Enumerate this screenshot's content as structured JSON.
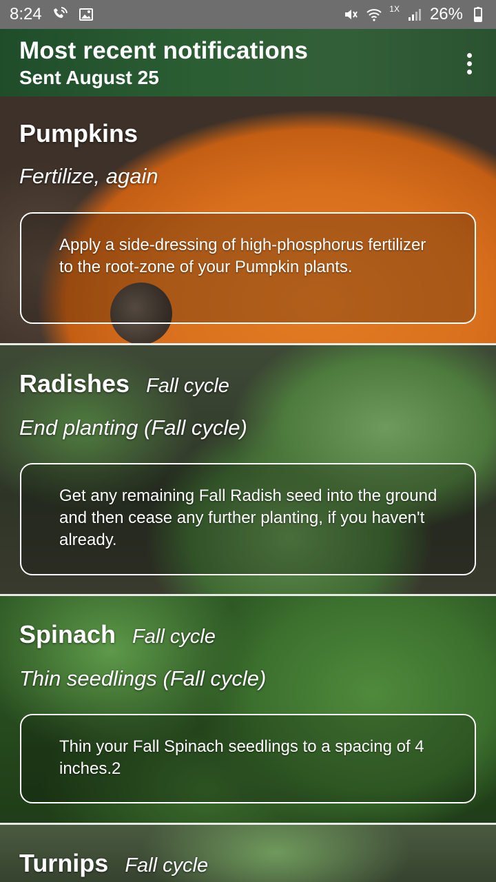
{
  "status_bar": {
    "time": "8:24",
    "left_icons": [
      "wifi-calling-icon",
      "image-icon"
    ],
    "right_icons": [
      "mute-icon",
      "wifi-icon",
      "signal-icon",
      "battery-icon"
    ],
    "network_tag": "1X",
    "battery": "26%"
  },
  "app_bar": {
    "title": "Most recent notifications",
    "subtitle": "Sent August 25",
    "menu_icon": "more-vert-icon"
  },
  "notifications": [
    {
      "crop": "Pumpkins",
      "cycle": "",
      "task": "Fertilize, again",
      "detail": "Apply a side-dressing of high-phosphorus fertilizer to the root-zone of your Pumpkin plants."
    },
    {
      "crop": "Radishes",
      "cycle": "Fall cycle",
      "task": "End planting (Fall cycle)",
      "detail": "Get any remaining Fall Radish seed into the ground and then cease any further planting, if you haven't already."
    },
    {
      "crop": "Spinach",
      "cycle": "Fall cycle",
      "task": "Thin seedlings (Fall cycle)",
      "detail": "Thin your Fall Spinach seedlings to a spacing of 4 inches.2"
    },
    {
      "crop": "Turnips",
      "cycle": "Fall cycle",
      "task": "",
      "detail": ""
    }
  ],
  "colors": {
    "status_bar": "#6e6e6e",
    "app_bar": "#2b5e33",
    "divider": "#e8ece6",
    "text": "#ffffff"
  }
}
